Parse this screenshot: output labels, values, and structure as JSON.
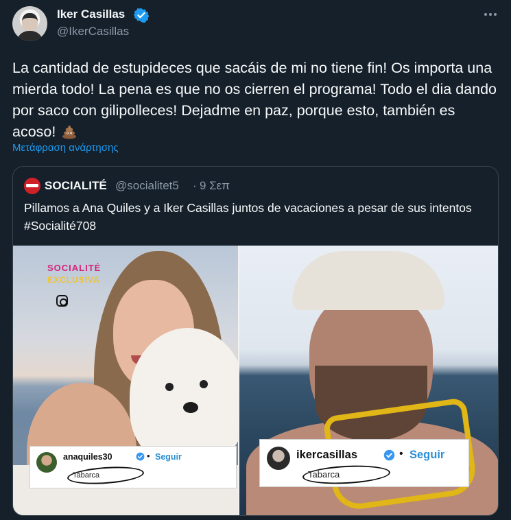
{
  "tweet": {
    "author_name": "Iker Casillas",
    "author_handle": "@IkerCasillas",
    "text": "La cantidad de estupideces que sacáis de mi no tiene fin! Os importa una mierda todo! La pena es que no os cierren el programa! Todo el dia dando por saco con gilipolleces! Dejadme en paz, porque esto, también es acoso!",
    "translate_label": "Μετάφραση ανάρτησης",
    "icons": [
      "more-options-icon",
      "verified-badge-icon",
      "poop-emoji"
    ]
  },
  "quote": {
    "author_name": "SOCIALITÉ",
    "author_handle": "@socialitet5",
    "separator": "·",
    "date": "9 Σεπ",
    "text": "Pillamos a Ana Quiles y a Iker Casillas juntos de vacaciones a pesar de sus intentos #Socialité708",
    "media": {
      "logo_text": "SOCIALITÉ",
      "logo_subtext": "EXCLUSIVA",
      "left_tag": {
        "username": "anaquiles30",
        "separator": "•",
        "follow": "Seguir",
        "location": "Tabarca"
      },
      "right_tag": {
        "username": "ikercasillas",
        "separator": "•",
        "follow": "Seguir",
        "location": "Tabarca"
      }
    }
  },
  "colors": {
    "background": "#15202b",
    "accent": "#1d9bf0",
    "muted": "#8b98a5",
    "border": "#38444d"
  }
}
